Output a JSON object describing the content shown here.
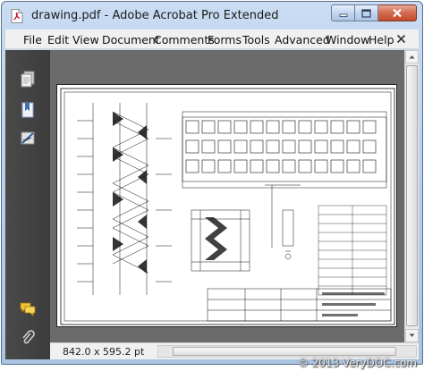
{
  "window": {
    "title": "drawing.pdf - Adobe Acrobat Pro Extended"
  },
  "menu": {
    "items": [
      "File",
      "Edit",
      "View",
      "Document",
      "Comments",
      "Forms",
      "Tools",
      "Advanced",
      "Window",
      "Help"
    ]
  },
  "navigation_panel": {
    "icons": [
      "pages-icon",
      "bookmarks-icon",
      "signatures-icon",
      "comments-icon",
      "attachments-icon"
    ]
  },
  "status": {
    "page_size": "842.0 x 595.2 pt"
  },
  "watermark": "© 2013 VeryDOC.com",
  "colors": {
    "title_bg": "#b5cde9",
    "close_button": "#c44a2c",
    "nav_panel": "#3c3c3c",
    "document_bg": "#6b6b6b"
  }
}
